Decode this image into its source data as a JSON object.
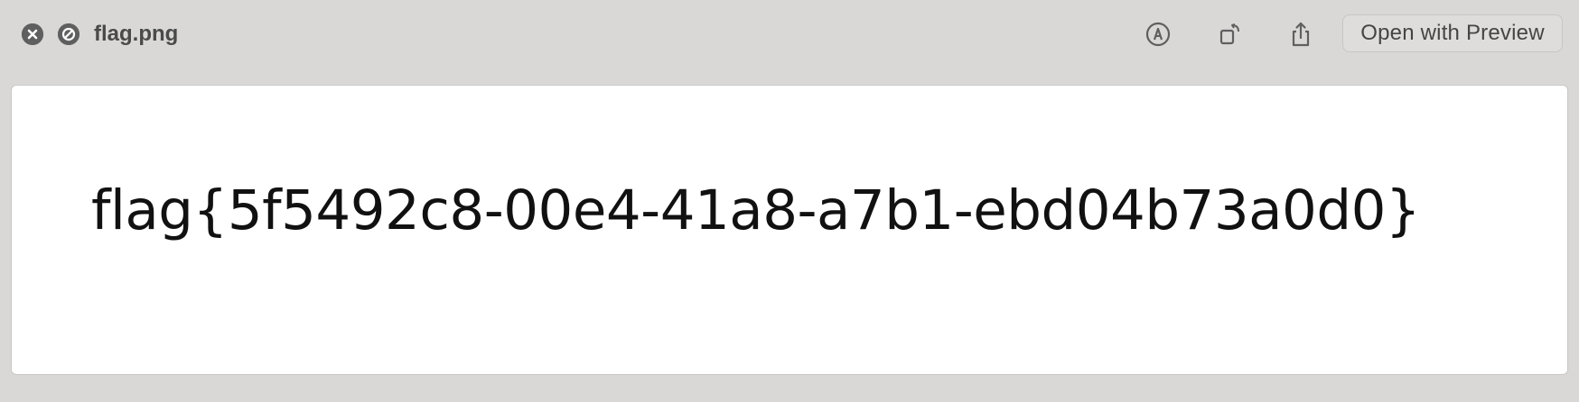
{
  "window": {
    "filename": "flag.png"
  },
  "toolbar": {
    "open_button_label": "Open with Preview",
    "icons": {
      "close": "close-circle-icon",
      "noentry": "no-entry-icon",
      "markup": "markup-pen-icon",
      "rotate": "rotate-icon",
      "share": "share-icon"
    }
  },
  "image": {
    "text": "flag{5f5492c8-00e4-41a8-a7b1-ebd04b73a0d0}"
  },
  "colors": {
    "background": "#d9d8d7",
    "icon": "#5f5f5f",
    "preview_bg": "#ffffff"
  }
}
